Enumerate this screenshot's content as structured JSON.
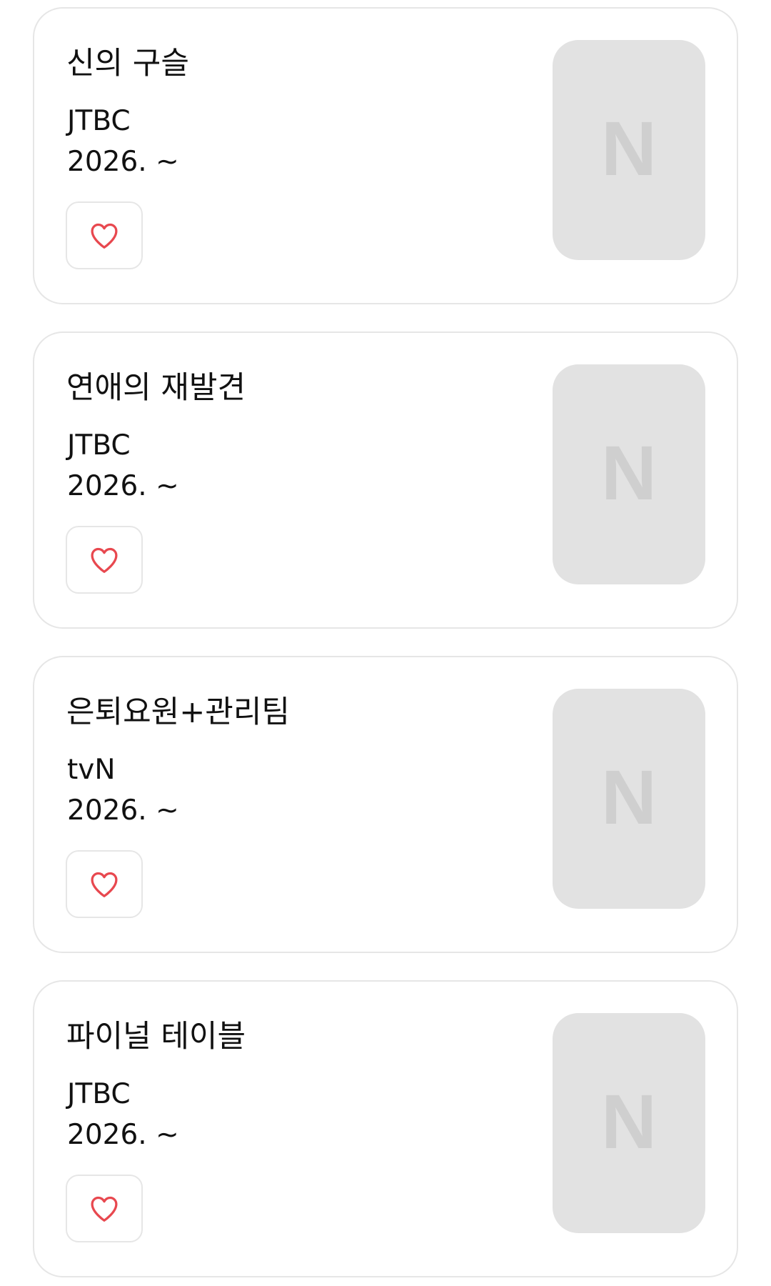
{
  "items": [
    {
      "title": "신의 구슬",
      "network": "JTBC",
      "date": "2026. ~",
      "placeholder_logo": "N"
    },
    {
      "title": "연애의 재발견",
      "network": "JTBC",
      "date": "2026. ~",
      "placeholder_logo": "N"
    },
    {
      "title": "은퇴요원+관리팀",
      "network": "tvN",
      "date": "2026. ~",
      "placeholder_logo": "N"
    },
    {
      "title": "파이널 테이블",
      "network": "JTBC",
      "date": "2026. ~",
      "placeholder_logo": "N"
    }
  ],
  "icons": {
    "like": "heart-outline-icon"
  },
  "colors": {
    "heart": "#e8484f",
    "card_border": "#e6e6e6",
    "placeholder_bg": "#e2e2e2",
    "placeholder_logo": "#cfcfcf",
    "text": "#111111"
  }
}
